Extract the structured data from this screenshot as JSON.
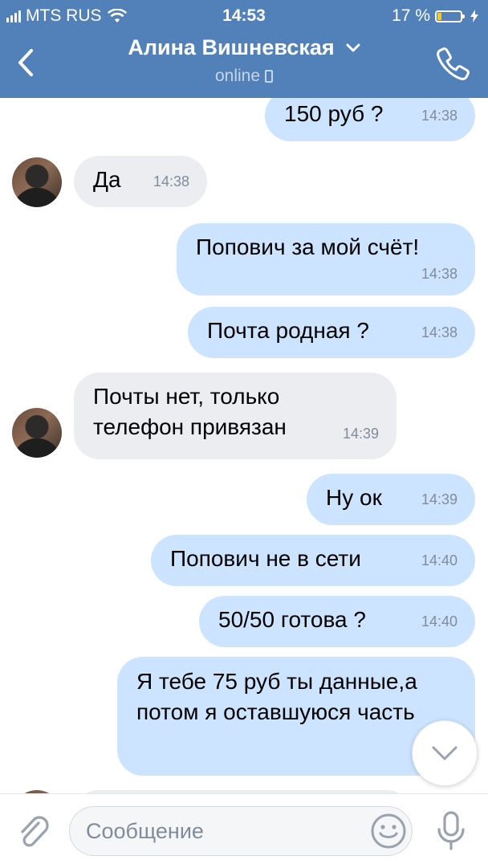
{
  "status_bar": {
    "carrier": "MTS RUS",
    "time": "14:53",
    "battery_percent": "17 %",
    "battery_level": 0.17
  },
  "header": {
    "contact_name": "Алина Вишневская",
    "presence": "online"
  },
  "messages": [
    {
      "direction": "out",
      "text": "150 руб ?",
      "time": "14:38"
    },
    {
      "direction": "in",
      "text": "Да",
      "time": "14:38"
    },
    {
      "direction": "out",
      "text": "Попович за мой счёт!",
      "time": "14:38"
    },
    {
      "direction": "out",
      "text": "Почта родная ?",
      "time": "14:38"
    },
    {
      "direction": "in",
      "text": "Почты нет, только телефон привязан",
      "time": "14:39"
    },
    {
      "direction": "out",
      "text": "Ну ок",
      "time": "14:39"
    },
    {
      "direction": "out",
      "text": "Попович не в сети",
      "time": "14:40"
    },
    {
      "direction": "out",
      "text": "50/50 готова ?",
      "time": "14:40"
    },
    {
      "direction": "out",
      "text": "Я тебе 75 руб ты данные,а потом я оставшуюся часть",
      "time": ""
    }
  ],
  "composer": {
    "placeholder": "Сообщение"
  },
  "colors": {
    "header_bg": "#5181b8",
    "outgoing_bubble": "#cce4ff",
    "incoming_bubble": "#ebedf0",
    "time_text": "#818c99"
  },
  "icons": {
    "back": "chevron-left-icon",
    "call": "phone-icon",
    "expand": "chevron-down-icon",
    "attach": "paperclip-icon",
    "emoji": "smile-icon",
    "mic": "microphone-icon",
    "scroll": "chevron-down-icon"
  }
}
